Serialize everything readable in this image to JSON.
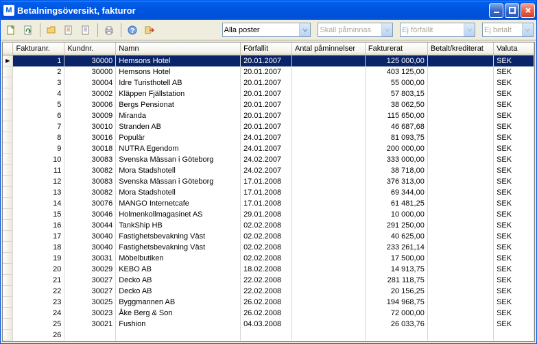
{
  "window": {
    "title": "Betalningsöversikt, fakturor",
    "app_icon_letter": "M"
  },
  "toolbar": {
    "filter": {
      "label": "Alla poster"
    },
    "reminder": {
      "label": "Skall påminnas"
    },
    "due": {
      "label": "Ej förfallit"
    },
    "paid": {
      "label": "Ej betalt"
    }
  },
  "columns": {
    "fakturanr": "Fakturanr.",
    "kundnr": "Kundnr.",
    "namn": "Namn",
    "forfallit": "Förfallit",
    "paminnelser": "Antal påminnelser",
    "fakturerat": "Fakturerat",
    "betalt": "Betalt/krediterat",
    "valuta": "Valuta"
  },
  "rows": [
    {
      "n": "1",
      "k": "30000",
      "namn": "Hemsons Hotel",
      "f": "20.01.2007",
      "p": "",
      "fa": "125 000,00",
      "b": "",
      "v": "SEK",
      "sel": true
    },
    {
      "n": "2",
      "k": "30000",
      "namn": "Hemsons Hotel",
      "f": "20.01.2007",
      "p": "",
      "fa": "403 125,00",
      "b": "",
      "v": "SEK"
    },
    {
      "n": "3",
      "k": "30004",
      "namn": "Idre Turisthotell AB",
      "f": "20.01.2007",
      "p": "",
      "fa": "55 000,00",
      "b": "",
      "v": "SEK"
    },
    {
      "n": "4",
      "k": "30002",
      "namn": "Kläppen Fjällstation",
      "f": "20.01.2007",
      "p": "",
      "fa": "57 803,15",
      "b": "",
      "v": "SEK"
    },
    {
      "n": "5",
      "k": "30006",
      "namn": "Bergs Pensionat",
      "f": "20.01.2007",
      "p": "",
      "fa": "38 062,50",
      "b": "",
      "v": "SEK"
    },
    {
      "n": "6",
      "k": "30009",
      "namn": "Miranda",
      "f": "20.01.2007",
      "p": "",
      "fa": "115 650,00",
      "b": "",
      "v": "SEK"
    },
    {
      "n": "7",
      "k": "30010",
      "namn": "Stranden AB",
      "f": "20.01.2007",
      "p": "",
      "fa": "46 687,68",
      "b": "",
      "v": "SEK"
    },
    {
      "n": "8",
      "k": "30016",
      "namn": "Populär",
      "f": "24.01.2007",
      "p": "",
      "fa": "81 093,75",
      "b": "",
      "v": "SEK"
    },
    {
      "n": "9",
      "k": "30018",
      "namn": "NUTRA Egendom",
      "f": "24.01.2007",
      "p": "",
      "fa": "200 000,00",
      "b": "",
      "v": "SEK"
    },
    {
      "n": "10",
      "k": "30083",
      "namn": "Svenska Mässan i Göteborg",
      "f": "24.02.2007",
      "p": "",
      "fa": "333 000,00",
      "b": "",
      "v": "SEK"
    },
    {
      "n": "11",
      "k": "30082",
      "namn": "Mora Stadshotell",
      "f": "24.02.2007",
      "p": "",
      "fa": "38 718,00",
      "b": "",
      "v": "SEK"
    },
    {
      "n": "12",
      "k": "30083",
      "namn": "Svenska Mässan i Göteborg",
      "f": "17.01.2008",
      "p": "",
      "fa": "376 313,00",
      "b": "",
      "v": "SEK"
    },
    {
      "n": "13",
      "k": "30082",
      "namn": "Mora Stadshotell",
      "f": "17.01.2008",
      "p": "",
      "fa": "69 344,00",
      "b": "",
      "v": "SEK"
    },
    {
      "n": "14",
      "k": "30076",
      "namn": "MANGO Internetcafe",
      "f": "17.01.2008",
      "p": "",
      "fa": "61 481,25",
      "b": "",
      "v": "SEK"
    },
    {
      "n": "15",
      "k": "30046",
      "namn": "Holmenkollmagasinet AS",
      "f": "29.01.2008",
      "p": "",
      "fa": "10 000,00",
      "b": "",
      "v": "SEK"
    },
    {
      "n": "16",
      "k": "30044",
      "namn": "TankShip HB",
      "f": "02.02.2008",
      "p": "",
      "fa": "291 250,00",
      "b": "",
      "v": "SEK"
    },
    {
      "n": "17",
      "k": "30040",
      "namn": "Fastighetsbevakning Väst",
      "f": "02.02.2008",
      "p": "",
      "fa": "40 625,00",
      "b": "",
      "v": "SEK"
    },
    {
      "n": "18",
      "k": "30040",
      "namn": "Fastighetsbevakning Väst",
      "f": "02.02.2008",
      "p": "",
      "fa": "233 261,14",
      "b": "",
      "v": "SEK"
    },
    {
      "n": "19",
      "k": "30031",
      "namn": "Möbelbutiken",
      "f": "02.02.2008",
      "p": "",
      "fa": "17 500,00",
      "b": "",
      "v": "SEK"
    },
    {
      "n": "20",
      "k": "30029",
      "namn": "KEBO AB",
      "f": "18.02.2008",
      "p": "",
      "fa": "14 913,75",
      "b": "",
      "v": "SEK"
    },
    {
      "n": "21",
      "k": "30027",
      "namn": "Decko AB",
      "f": "22.02.2008",
      "p": "",
      "fa": "281 118,75",
      "b": "",
      "v": "SEK"
    },
    {
      "n": "22",
      "k": "30027",
      "namn": "Decko AB",
      "f": "22.02.2008",
      "p": "",
      "fa": "20 156,25",
      "b": "",
      "v": "SEK"
    },
    {
      "n": "23",
      "k": "30025",
      "namn": "Byggmannen AB",
      "f": "26.02.2008",
      "p": "",
      "fa": "194 968,75",
      "b": "",
      "v": "SEK"
    },
    {
      "n": "24",
      "k": "30023",
      "namn": "Åke Berg & Son",
      "f": "26.02.2008",
      "p": "",
      "fa": "72 000,00",
      "b": "",
      "v": "SEK"
    },
    {
      "n": "25",
      "k": "30021",
      "namn": "Fushion",
      "f": "04.03.2008",
      "p": "",
      "fa": "26 033,76",
      "b": "",
      "v": "SEK"
    },
    {
      "n": "26",
      "k": "",
      "namn": "",
      "f": "",
      "p": "",
      "fa": "",
      "b": "",
      "v": ""
    }
  ]
}
